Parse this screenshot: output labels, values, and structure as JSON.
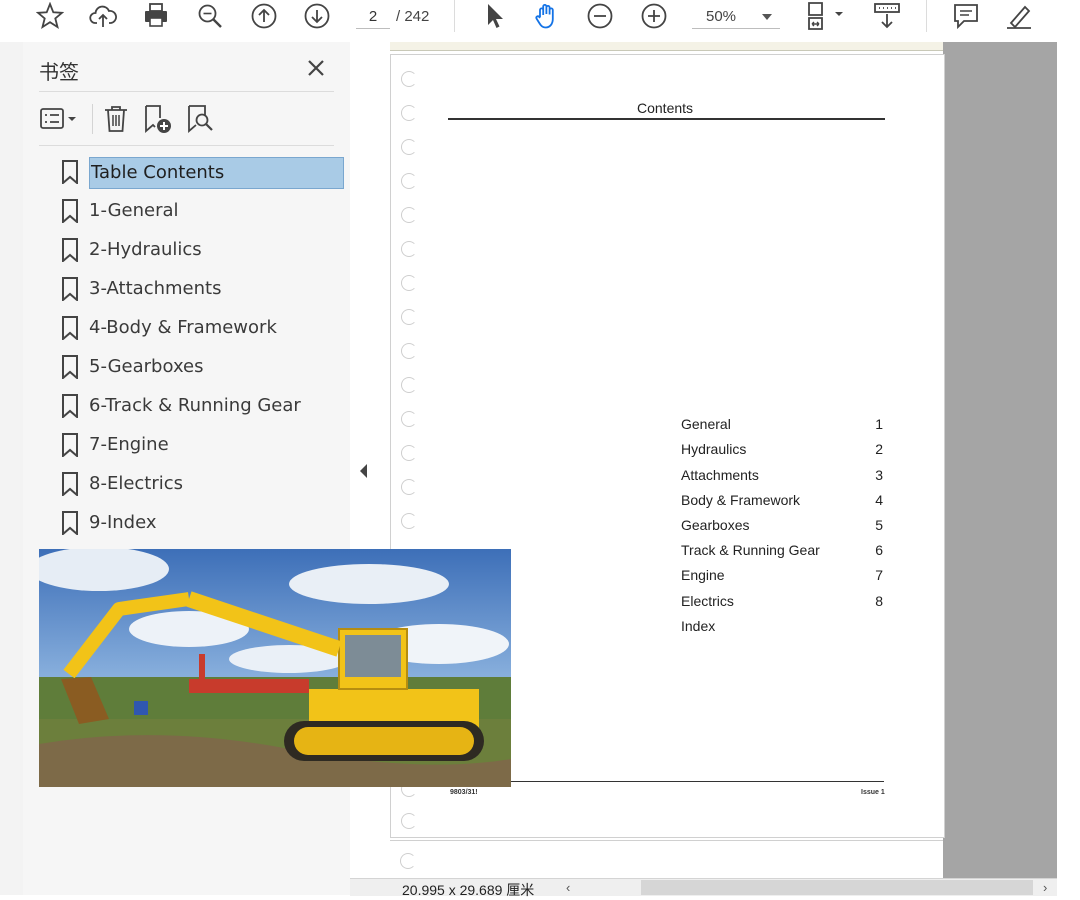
{
  "toolbar": {
    "current_page": "2",
    "total_pages": "/ 242",
    "zoom": "50%",
    "icons": [
      "star-icon",
      "upload-cloud-icon",
      "print-icon",
      "zoom-search-icon",
      "page-up-icon",
      "page-down-icon",
      "select-arrow-icon",
      "hand-pan-icon",
      "zoom-out-icon",
      "zoom-in-icon",
      "fit-page-icon",
      "scroll-mode-icon",
      "comment-icon",
      "highlight-pen-icon"
    ]
  },
  "bookmarks": {
    "title": "书签",
    "items": [
      {
        "label": "Table Contents",
        "selected": true
      },
      {
        "label": "1-General"
      },
      {
        "label": "2-Hydraulics"
      },
      {
        "label": "3-Attachments"
      },
      {
        "label": "4-Body & Framework"
      },
      {
        "label": "5-Gearboxes"
      },
      {
        "label": "6-Track & Running Gear"
      },
      {
        "label": "7-Engine"
      },
      {
        "label": "8-Electrics"
      },
      {
        "label": "9-Index"
      }
    ]
  },
  "document": {
    "title": "Contents",
    "toc": [
      {
        "name": "General",
        "num": "1"
      },
      {
        "name": "Hydraulics",
        "num": "2"
      },
      {
        "name": "Attachments",
        "num": "3"
      },
      {
        "name": "Body & Framework",
        "num": "4"
      },
      {
        "name": "Gearboxes",
        "num": "5"
      },
      {
        "name": "Track & Running Gear",
        "num": "6"
      },
      {
        "name": "Engine",
        "num": "7"
      },
      {
        "name": "Electrics",
        "num": "8"
      },
      {
        "name": "Index",
        "num": ""
      }
    ],
    "footer_left": "9803/31!",
    "footer_right": "Issue 1"
  },
  "status": {
    "page_size": "20.995 x 29.689 厘米"
  },
  "colors": {
    "selection": "#a9cbe6",
    "hand_tool_active": "#1473e6",
    "doc_background": "#a5a5a5"
  }
}
